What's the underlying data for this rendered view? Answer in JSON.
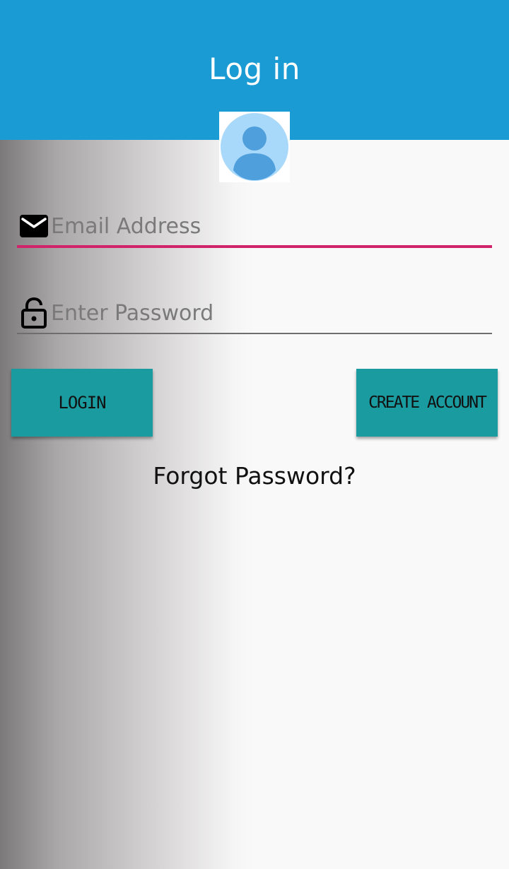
{
  "header": {
    "title": "Log in",
    "background_color": "#1a9bd4"
  },
  "avatar": {
    "icon": "user-avatar-icon"
  },
  "email": {
    "icon": "mail-icon",
    "placeholder": "Email Address",
    "value": "",
    "underline_color": "#d0236a"
  },
  "password": {
    "icon": "lock-icon",
    "placeholder": "Enter Password",
    "value": ""
  },
  "buttons": {
    "login_label": "LOGIN",
    "create_account_label": "CREATE ACCOUNT",
    "color": "#1a9ba0"
  },
  "forgot_password_label": "Forgot Password?"
}
